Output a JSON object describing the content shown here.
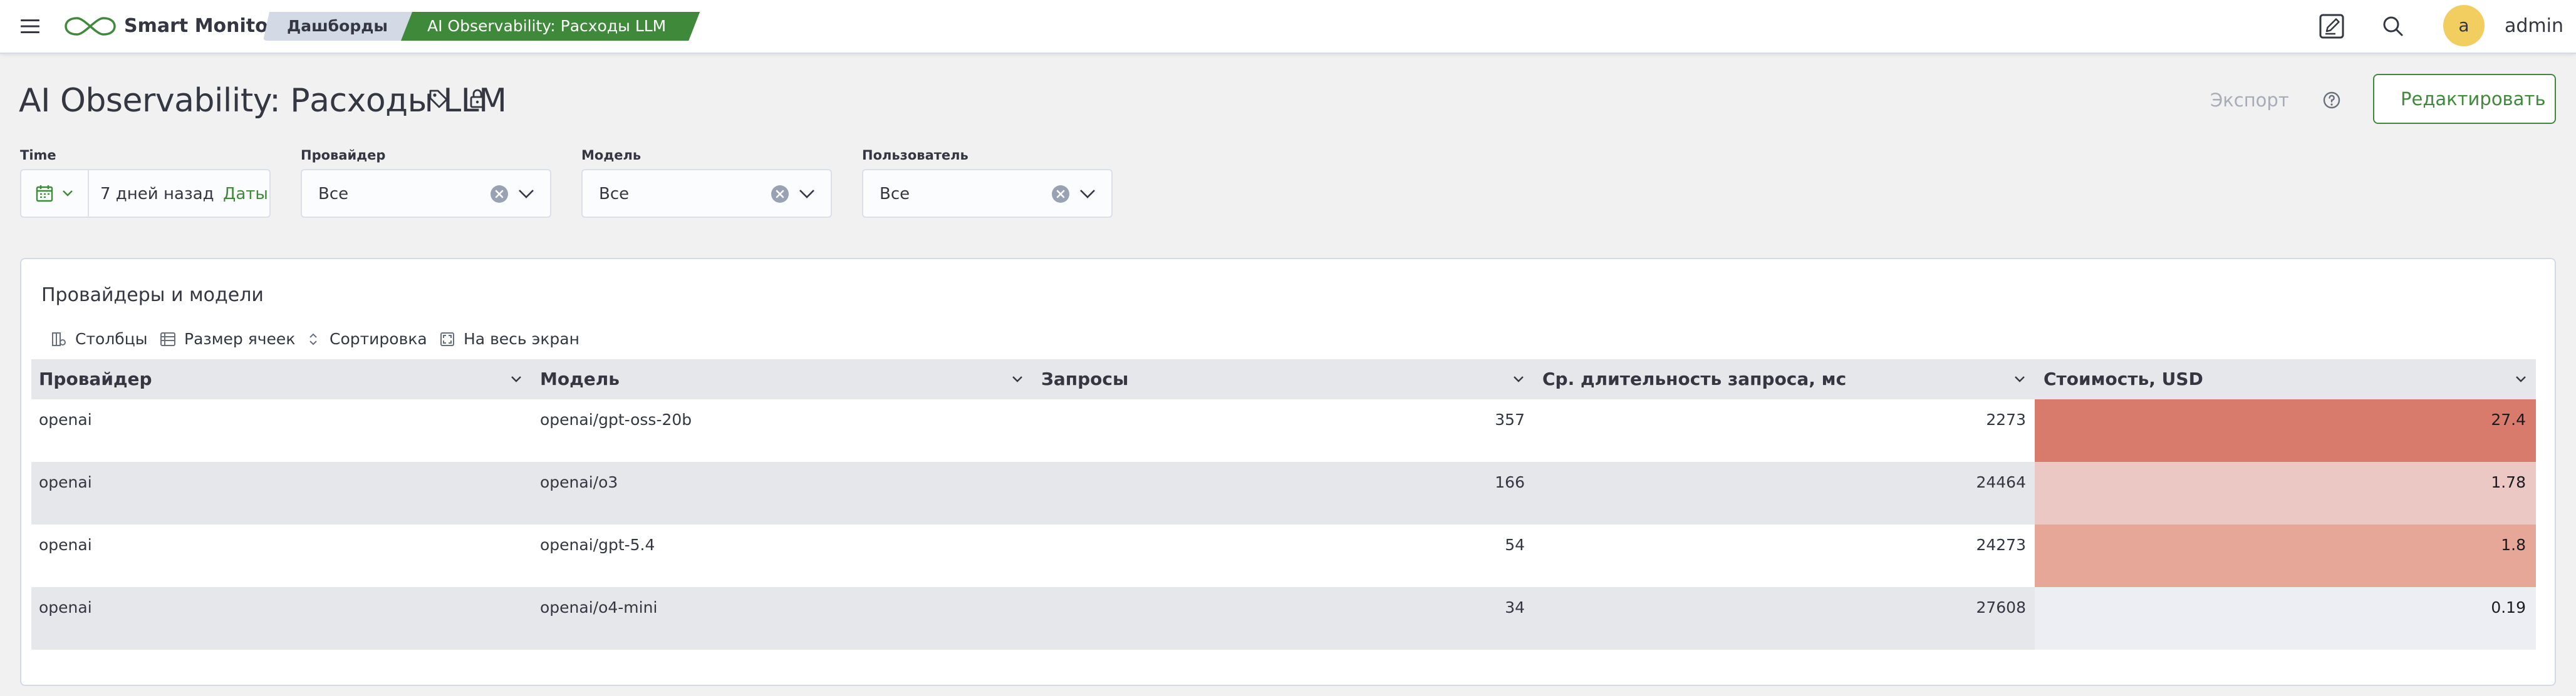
{
  "topbar": {
    "app_name": "Smart Monitor",
    "breadcrumbs": [
      "Дашборды",
      "AI Observability: Расходы LLM"
    ],
    "avatar_letter": "a",
    "user_name": "admin"
  },
  "header": {
    "title": "AI Observability: Расходы LLM",
    "export_label": "Экспорт",
    "edit_label": "Редактировать"
  },
  "filters": {
    "time": {
      "label": "Time",
      "value": "7 дней назад",
      "dates_link": "Даты"
    },
    "provider": {
      "label": "Провайдер",
      "value": "Все"
    },
    "model": {
      "label": "Модель",
      "value": "Все"
    },
    "user": {
      "label": "Пользователь",
      "value": "Все"
    }
  },
  "panel": {
    "title": "Провайдеры и модели",
    "toolbar": [
      "Столбцы",
      "Размер ячеек",
      "Сортировка",
      "На весь экран"
    ],
    "columns": [
      "Провайдер",
      "Модель",
      "Запросы",
      "Ср. длительность запроса, мс",
      "Стоимость, USD"
    ],
    "rows": [
      {
        "provider": "openai",
        "model": "openai/gpt-oss-20b",
        "requests": "357",
        "duration": "2273",
        "cost": "27.4"
      },
      {
        "provider": "openai",
        "model": "openai/o3",
        "requests": "166",
        "duration": "24464",
        "cost": "1.78"
      },
      {
        "provider": "openai",
        "model": "openai/gpt-5.4",
        "requests": "54",
        "duration": "24273",
        "cost": "1.8"
      },
      {
        "provider": "openai",
        "model": "openai/o4-mini",
        "requests": "34",
        "duration": "27608",
        "cost": "0.19"
      }
    ],
    "cost_colors": [
      "#d97b6c",
      "#ebc8c3",
      "#e6a698",
      "#eceef4"
    ]
  },
  "colors": {
    "accent": "#3f8a3a",
    "avatar": "#f2cd60"
  }
}
